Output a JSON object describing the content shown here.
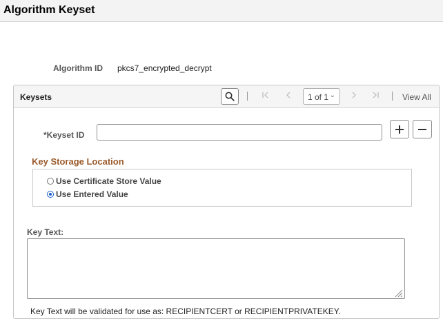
{
  "page": {
    "title": "Algorithm Keyset"
  },
  "algorithm": {
    "label": "Algorithm ID",
    "value": "pkcs7_encrypted_decrypt"
  },
  "keysets": {
    "title": "Keysets",
    "pagination": {
      "selected_page": "1 of 1",
      "view_all": "View All"
    },
    "keyset_id": {
      "label": "*Keyset ID",
      "value": "",
      "placeholder": ""
    },
    "key_storage": {
      "title": "Key Storage Location",
      "options": [
        {
          "label": "Use Certificate Store Value",
          "selected": false
        },
        {
          "label": "Use Entered Value",
          "selected": true
        }
      ]
    },
    "key_text": {
      "label": "Key Text:",
      "value": "",
      "note": "Key Text will be validated for use as: RECIPIENTCERT or RECIPIENTPRIVATEKEY."
    }
  },
  "icons": {
    "search": "search-icon",
    "first": "first-page-icon",
    "previous": "previous-page-icon",
    "next": "next-page-icon",
    "last": "last-page-icon",
    "add": "plus-icon",
    "remove": "minus-icon"
  },
  "colors": {
    "section_title": "#9a5a2a",
    "radio_selected": "#1a5fcc",
    "header_bg": "#f3f3f3"
  }
}
